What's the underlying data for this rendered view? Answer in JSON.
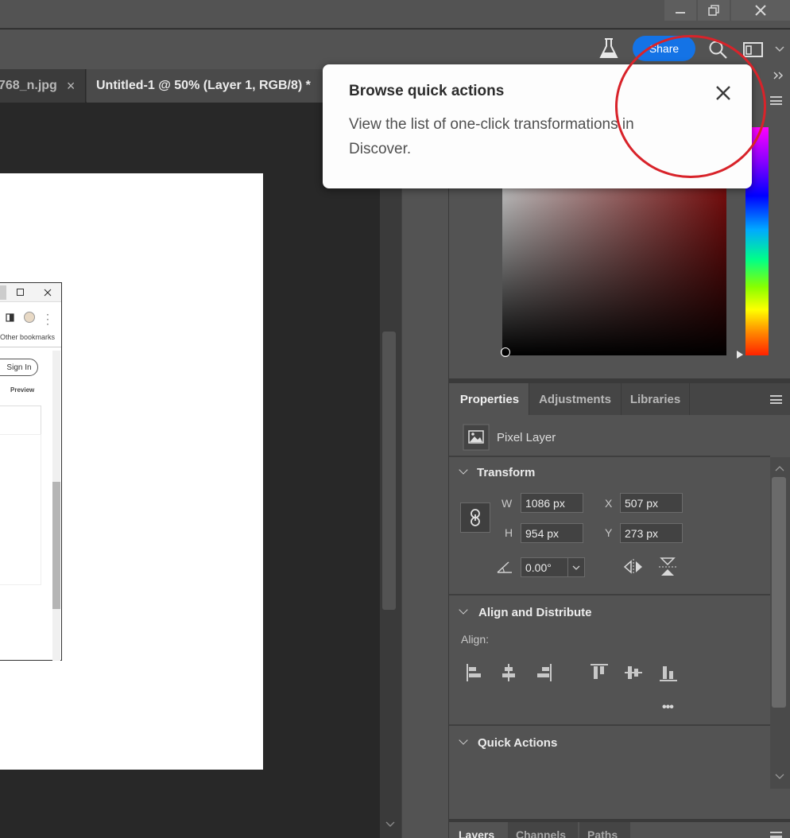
{
  "window": {
    "controls": {
      "minimize": "minimize-icon",
      "restore": "restore-icon",
      "close": "close-icon"
    }
  },
  "optionsbar": {
    "share_label": "Share",
    "icons": [
      "flask-icon",
      "search-icon",
      "workspace-icon",
      "chevron-down-icon"
    ]
  },
  "tabs": [
    {
      "label": "768_n.jpg",
      "close": "×"
    },
    {
      "label": "Untitled-1 @ 50% (Layer 1, RGB/8) *"
    }
  ],
  "embedded": {
    "other_bookmarks": "Other bookmarks",
    "sign_in": "Sign In",
    "preview": "Preview"
  },
  "popover": {
    "title": "Browse quick actions",
    "body": "View the list of one-click transformations in Discover."
  },
  "panels": {
    "tabs": [
      "Properties",
      "Adjustments",
      "Libraries"
    ],
    "layer_type": "Pixel Layer",
    "transform": {
      "title": "Transform",
      "w_label": "W",
      "w_value": "1086 px",
      "h_label": "H",
      "h_value": "954 px",
      "x_label": "X",
      "x_value": "507 px",
      "y_label": "Y",
      "y_value": "273 px",
      "angle_value": "0.00°"
    },
    "align": {
      "title": "Align and Distribute",
      "align_label": "Align:",
      "more": "•••"
    },
    "quick_actions": {
      "title": "Quick Actions"
    },
    "bottom_tabs": [
      "Layers",
      "Channels",
      "Paths"
    ]
  },
  "colors": {
    "accent": "#1473e6",
    "annotation": "#d8232a",
    "panel": "#535353",
    "canvas": "#282828"
  }
}
